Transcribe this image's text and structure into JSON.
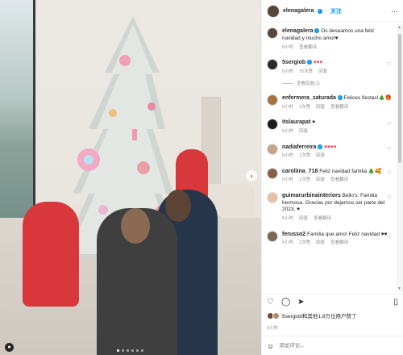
{
  "header": {
    "username": "elenagalera",
    "follow_label": "关注",
    "more_label": "···"
  },
  "caption": {
    "username": "elenagalera",
    "text": "Os deseamos una feliz navidad y mucho amor♥",
    "time": "5小时",
    "translation": "查看翻译"
  },
  "comments": [
    {
      "username": "5sergiob",
      "text": "♥♥♥",
      "time": "5小时",
      "likes": "76次赞",
      "reply": "回复",
      "translation": "",
      "view_replies": "查看回复(1)"
    },
    {
      "username": "enfermera_saturada",
      "text": "Felices fiestas!🎄🎁",
      "time": "5小时",
      "likes": "2次赞",
      "reply": "回复",
      "translation": "查看翻译",
      "view_replies": ""
    },
    {
      "username": "itslaurapat",
      "text": "♥",
      "time": "5小时",
      "likes": "",
      "reply": "回复",
      "translation": "",
      "view_replies": ""
    },
    {
      "username": "nadiaferreira",
      "text": "♥♥♥♥",
      "time": "5小时",
      "likes": "1次赞",
      "reply": "回复",
      "translation": "",
      "view_replies": ""
    },
    {
      "username": "caroliina_718",
      "text": "Feliz navidad familia 🎄🥰",
      "time": "5小时",
      "likes": "1次赞",
      "reply": "回复",
      "translation": "查看翻译",
      "view_replies": ""
    },
    {
      "username": "guimarurbinainteriors",
      "text": "Bello's: Familia hermosa. Gracias por dejarnos ser parte del 2023. ♥",
      "time": "5小时",
      "likes": "",
      "reply": "回复",
      "translation": "查看翻译",
      "view_replies": ""
    },
    {
      "username": "ferusso2",
      "text": "Familia que amo! Feliz navidad ♥♥",
      "time": "5小时",
      "likes": "2次赞",
      "reply": "回复",
      "translation": "查看翻译",
      "view_replies": ""
    }
  ],
  "likes_text": "5sergiob和其他1.8万位用户赞了",
  "post_time": "5小时",
  "add_comment": {
    "placeholder": "添加评论..."
  },
  "colors": {
    "accent": "#0095f6",
    "text": "#262626",
    "muted": "#8e8e8e"
  }
}
